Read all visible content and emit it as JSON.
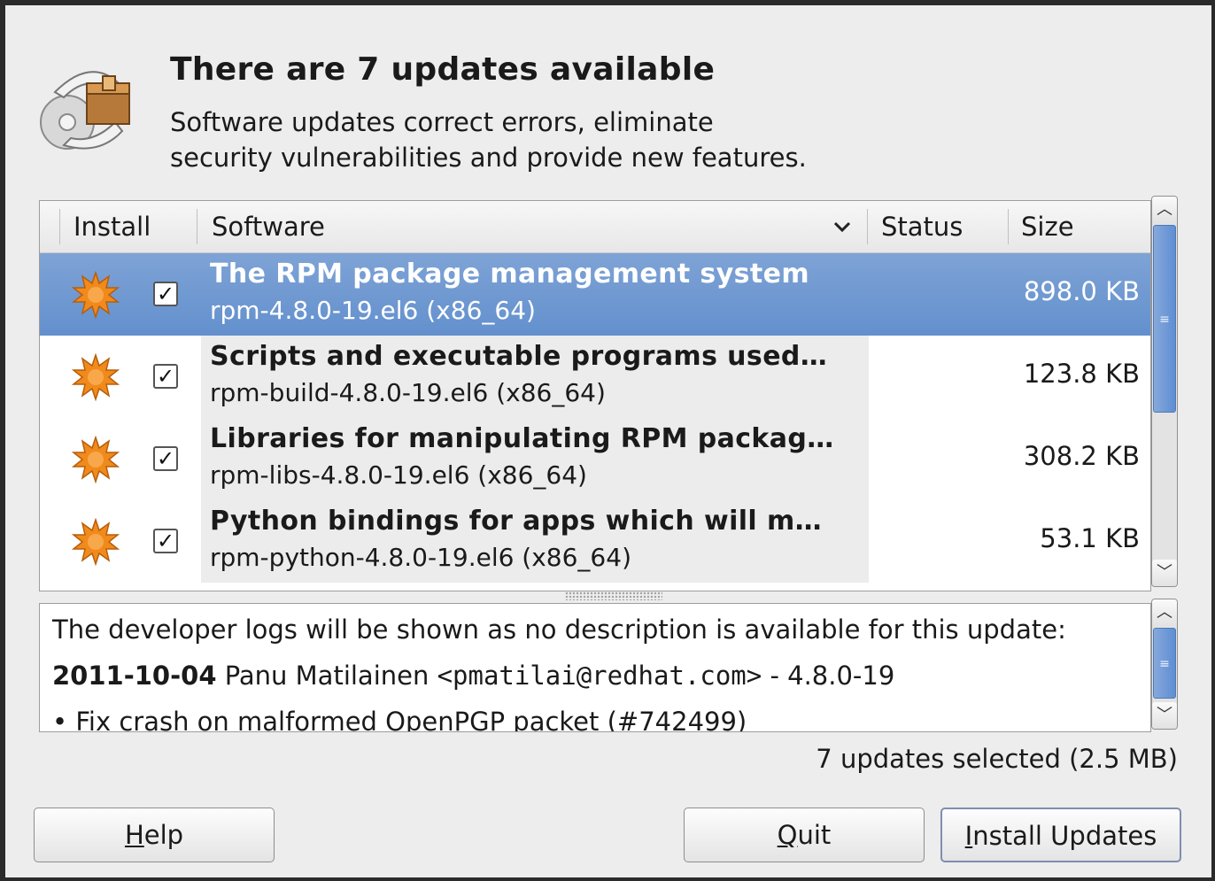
{
  "header": {
    "title": "There are 7 updates available",
    "subtitle_line1": "Software updates correct errors, eliminate",
    "subtitle_line2": "security vulnerabilities and provide new features."
  },
  "columns": {
    "install": "Install",
    "software": "Software",
    "status": "Status",
    "size": "Size"
  },
  "updates": [
    {
      "name": "The RPM package management system",
      "version": "rpm-4.8.0-19.el6 (x86_64)",
      "size": "898.0 KB",
      "checked": "✓"
    },
    {
      "name": "Scripts and executable programs used…",
      "version": "rpm-build-4.8.0-19.el6 (x86_64)",
      "size": "123.8 KB",
      "checked": "✓"
    },
    {
      "name": "Libraries for manipulating RPM packag…",
      "version": "rpm-libs-4.8.0-19.el6 (x86_64)",
      "size": "308.2 KB",
      "checked": "✓"
    },
    {
      "name": "Python bindings for apps which will m…",
      "version": "rpm-python-4.8.0-19.el6 (x86_64)",
      "size": "53.1 KB",
      "checked": "✓"
    }
  ],
  "description": {
    "intro": "The developer logs will be shown as no description is available for this update:",
    "date": "2011-10-04",
    "author": " Panu Matilainen ",
    "email": "<pmatilai@redhat.com>",
    "version_suffix": " - 4.8.0-19",
    "bullet": "• Fix crash on malformed OpenPGP packet (#742499)"
  },
  "summary": "7 updates selected (2.5 MB)",
  "buttons": {
    "help_mnemonic": "H",
    "help_rest": "elp",
    "quit_mnemonic": "Q",
    "quit_rest": "uit",
    "install_mnemonic": "I",
    "install_rest": "nstall Updates"
  },
  "colors": {
    "selection": "#6f99d2",
    "accent_star": "#f08a1c"
  },
  "icons": {
    "header": "software-update-icon",
    "row": "security-update-star-icon",
    "sort": "chevron-down-icon"
  }
}
